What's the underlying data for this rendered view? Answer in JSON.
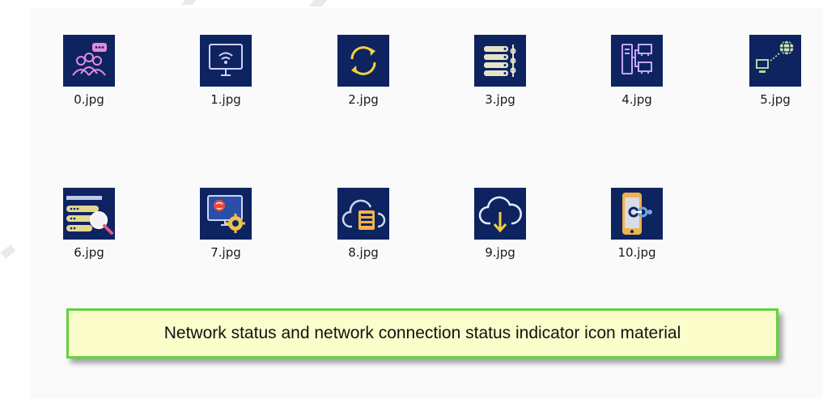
{
  "files": [
    {
      "name": "0.jpg",
      "icon": "users-chat-icon"
    },
    {
      "name": "1.jpg",
      "icon": "monitor-wifi-icon"
    },
    {
      "name": "2.jpg",
      "icon": "refresh-sync-icon"
    },
    {
      "name": "3.jpg",
      "icon": "server-rack-icon"
    },
    {
      "name": "4.jpg",
      "icon": "network-computers-icon"
    },
    {
      "name": "5.jpg",
      "icon": "computer-globe-icon"
    },
    {
      "name": "6.jpg",
      "icon": "server-search-icon"
    },
    {
      "name": "7.jpg",
      "icon": "monitor-settings-icon"
    },
    {
      "name": "8.jpg",
      "icon": "cloud-server-icon"
    },
    {
      "name": "9.jpg",
      "icon": "cloud-download-icon"
    },
    {
      "name": "10.jpg",
      "icon": "phone-link-icon"
    }
  ],
  "caption": "Network status and network connection status indicator icon material",
  "colors": {
    "thumb_background": "#0d2461",
    "caption_background": "#fbfecb",
    "caption_border": "#5fd43a"
  }
}
